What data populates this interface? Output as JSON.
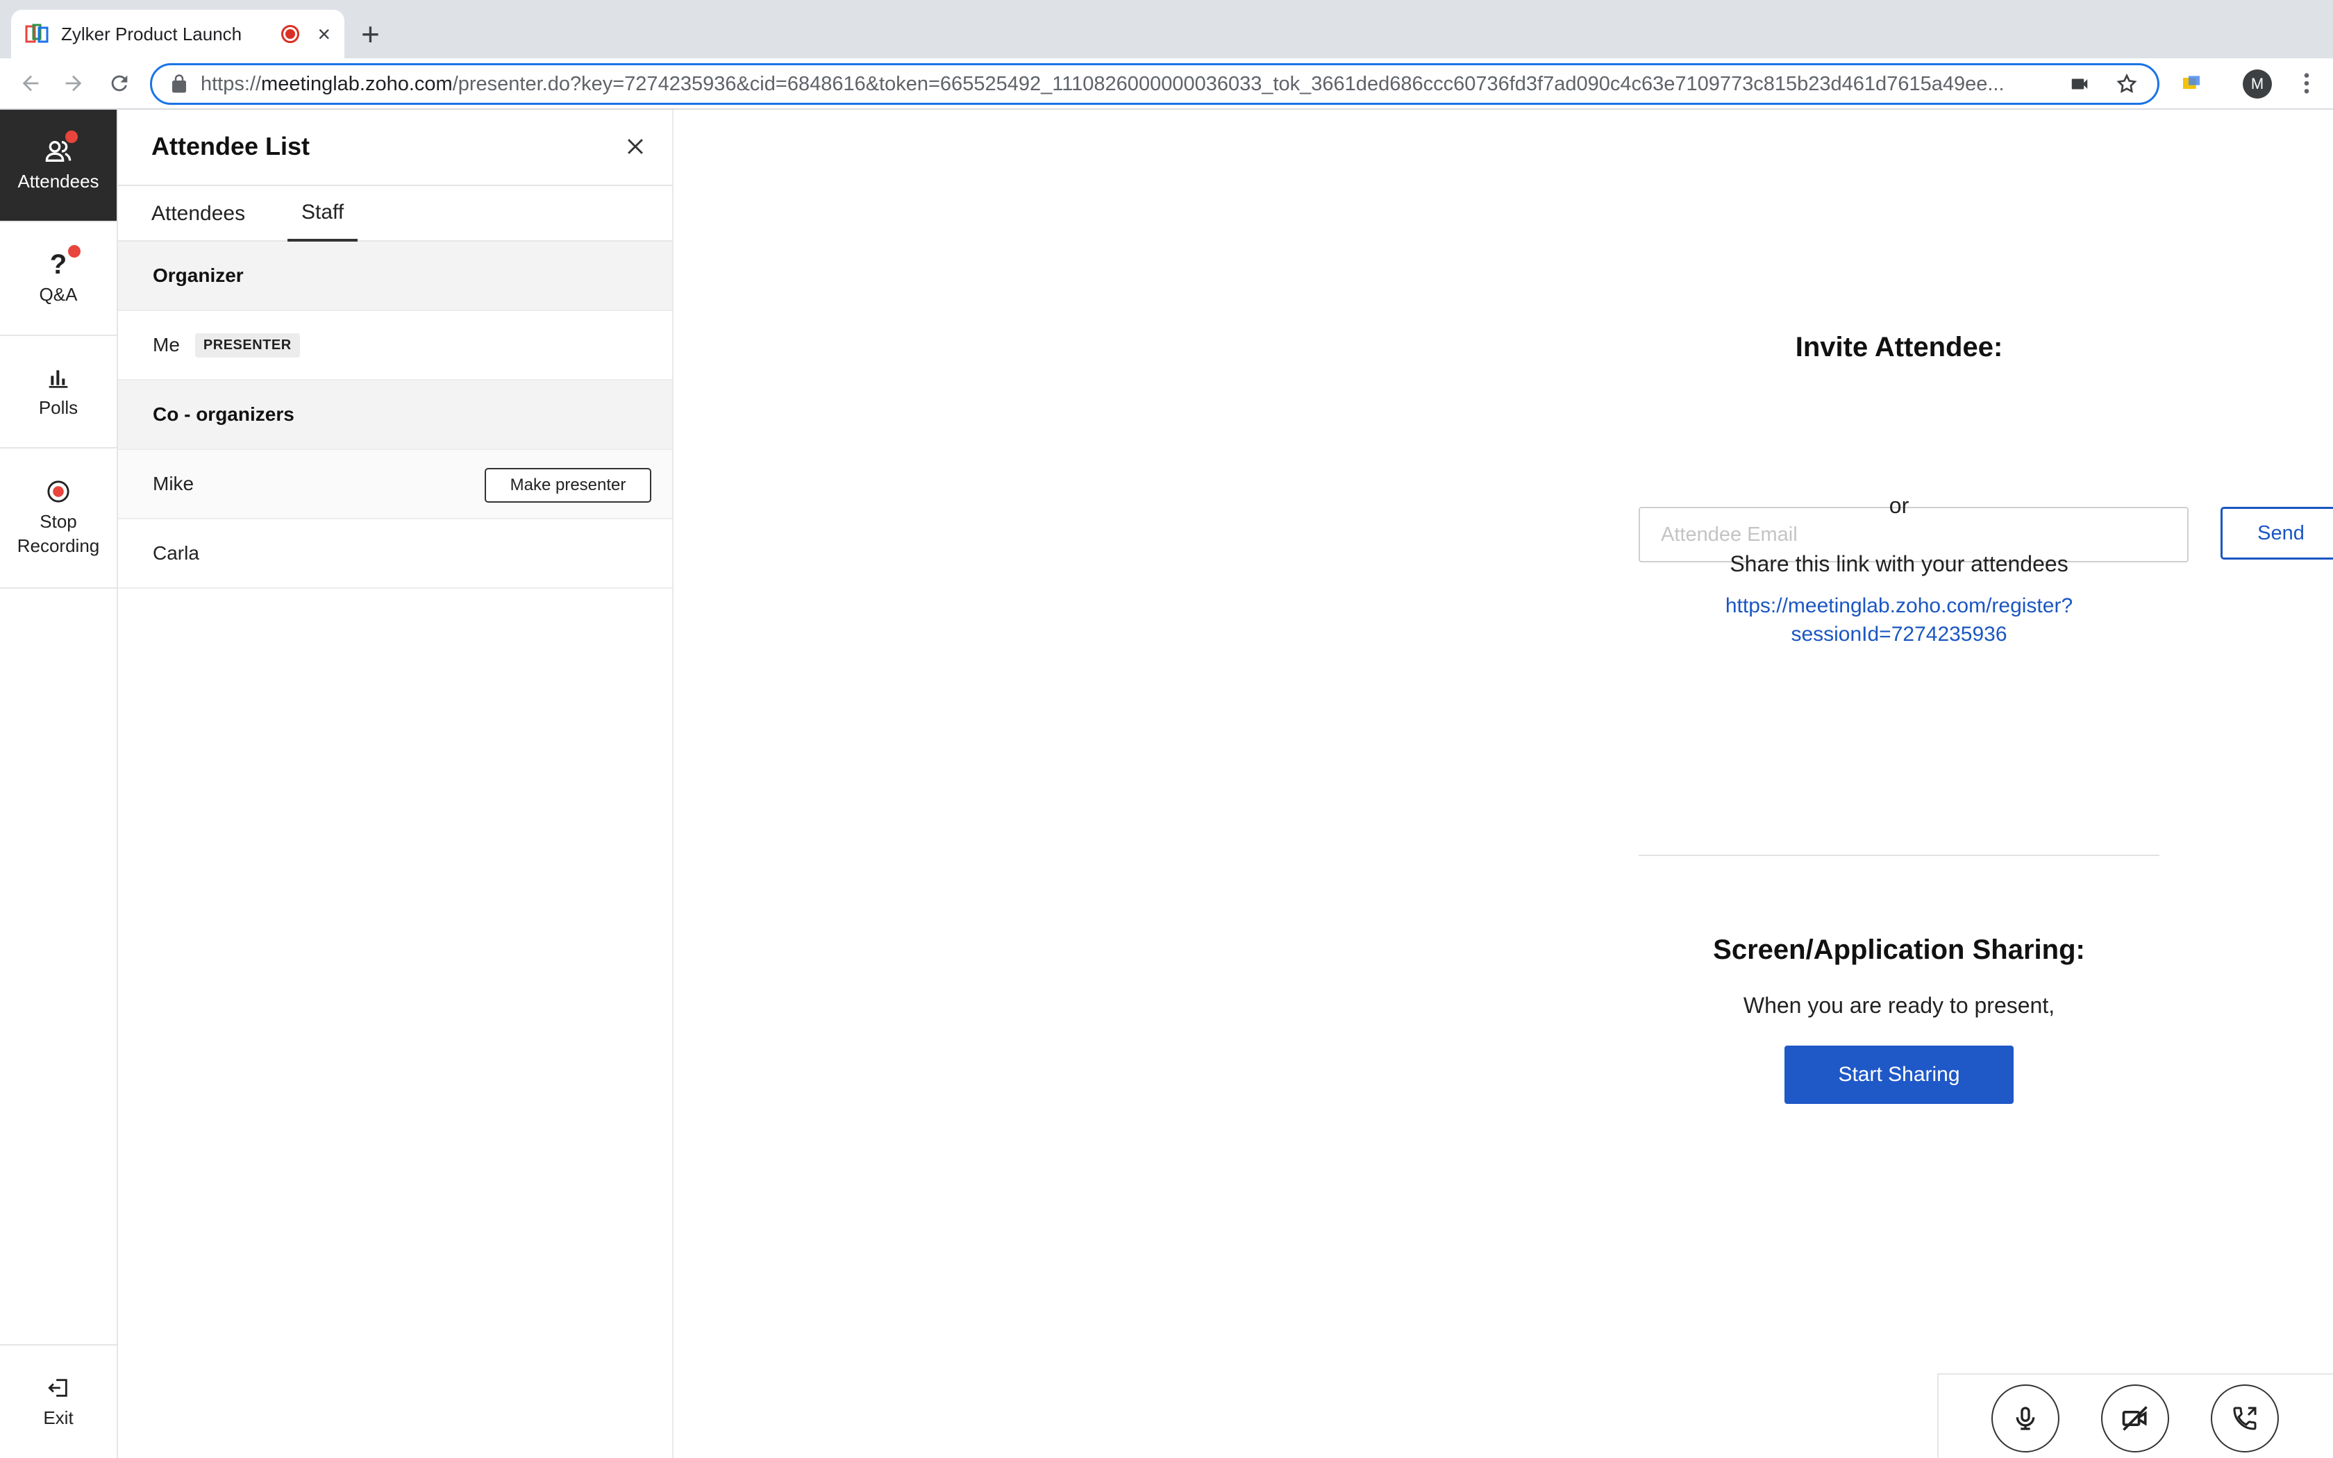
{
  "browser": {
    "tab_title": "Zylker Product Launch",
    "url_prefix": "https://",
    "url_host": "meetinglab.zoho.com",
    "url_path": "/presenter.do?key=7274235936&cid=6848616&token=665525492_1110826000000036033_tok_3661ded686ccc60736fd3f7ad090c4c63e7109773c815b23d461d7615a49ee...",
    "profile_initial": "M"
  },
  "rail": {
    "items": [
      {
        "label": "Attendees",
        "icon": "attendees-icon",
        "active": true,
        "badge": true
      },
      {
        "label": "Q&A",
        "icon": "question-icon",
        "badge": true
      },
      {
        "label": "Polls",
        "icon": "bar-chart-icon"
      },
      {
        "label": "Stop Recording",
        "icon": "record-icon"
      }
    ],
    "exit_label": "Exit"
  },
  "panel": {
    "title": "Attendee List",
    "tabs": [
      "Attendees",
      "Staff"
    ],
    "active_tab": "Staff",
    "organizer_header": "Organizer",
    "organizer_name": "Me",
    "organizer_badge": "PRESENTER",
    "coorganizers_header": "Co - organizers",
    "coorganizers": [
      {
        "name": "Mike",
        "action": "Make presenter"
      },
      {
        "name": "Carla"
      }
    ]
  },
  "main": {
    "invite_title": "Invite Attendee:",
    "email_placeholder": "Attendee Email",
    "send_label": "Send",
    "or_text": "or",
    "share_text": "Share this link with your attendees",
    "share_link_line1": "https://meetinglab.zoho.com/register?",
    "share_link_line2": "sessionId=7274235936",
    "sharing_title": "Screen/Application Sharing:",
    "sharing_text": "When you are ready to present,",
    "start_label": "Start Sharing"
  },
  "colors": {
    "accent": "#1f58c7",
    "rail_active": "#2b2b2b",
    "badge": "#e8453c"
  }
}
